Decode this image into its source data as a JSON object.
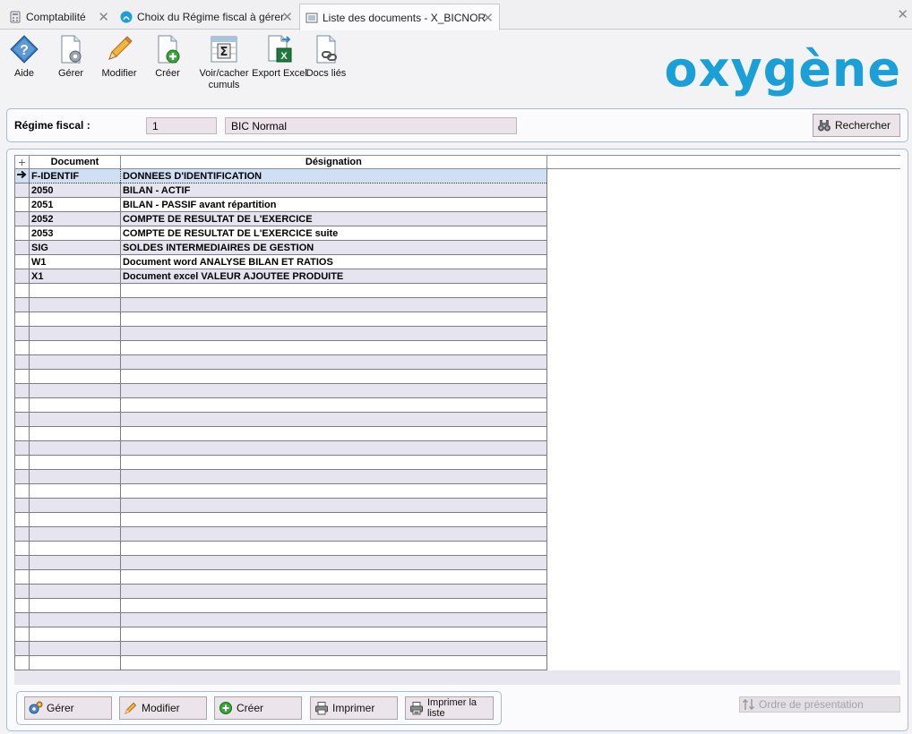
{
  "tabs": [
    {
      "label": "Comptabilité",
      "icon": "calculator-icon"
    },
    {
      "label": "Choix du Régime fiscal à gérer",
      "icon": "oxygene-logo-icon"
    },
    {
      "label": "Liste des documents - X_BICNOR",
      "icon": "list-icon",
      "active": true
    }
  ],
  "toolbar": {
    "aide": "Aide",
    "gerer": "Gérer",
    "modifier": "Modifier",
    "creer": "Créer",
    "voir_cumuls": "Voir/cacher cumuls",
    "export_excel": "Export Excel",
    "docs_lies": "Docs liés"
  },
  "brand": "oxygène",
  "regime": {
    "label": "Régime fiscal :",
    "code": "1",
    "name": "BIC Normal",
    "search_button": "Rechercher"
  },
  "grid": {
    "columns": [
      "Document",
      "Désignation"
    ],
    "rows": [
      {
        "document": "F-IDENTIF",
        "designation": "DONNEES D'IDENTIFICATION"
      },
      {
        "document": "2050",
        "designation": "BILAN - ACTIF"
      },
      {
        "document": "2051",
        "designation": "BILAN - PASSIF avant répartition"
      },
      {
        "document": "2052",
        "designation": "COMPTE DE RESULTAT DE L'EXERCICE"
      },
      {
        "document": "2053",
        "designation": "COMPTE DE RESULTAT DE L'EXERCICE suite"
      },
      {
        "document": "SIG",
        "designation": "SOLDES INTERMEDIAIRES DE GESTION"
      },
      {
        "document": "W1",
        "designation": "Document word ANALYSE BILAN ET RATIOS"
      },
      {
        "document": "X1",
        "designation": "Document excel VALEUR AJOUTEE PRODUITE"
      }
    ]
  },
  "bottom": {
    "gerer": "Gérer",
    "modifier": "Modifier",
    "creer": "Créer",
    "imprimer": "Imprimer",
    "imprimer_liste": "Imprimer la liste",
    "ordre": "Ordre de présentation"
  },
  "colors": {
    "accent": "#1a9fd6",
    "border": "#a9bccf",
    "field_bg": "#ebe2ea",
    "row_alt": "#e6e4ee"
  }
}
